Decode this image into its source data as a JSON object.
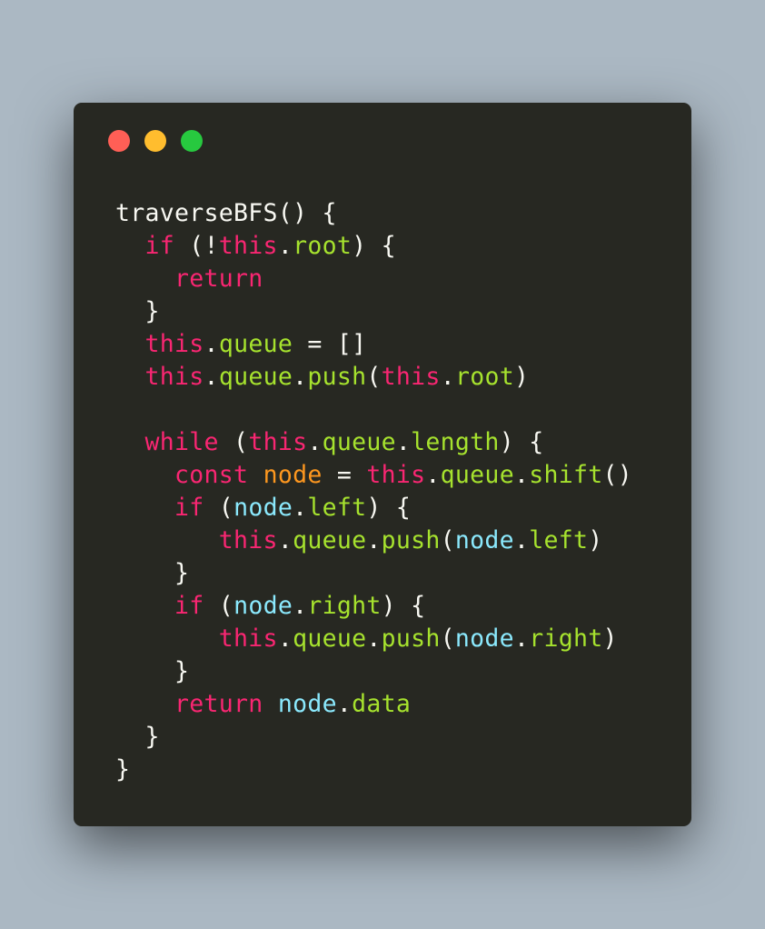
{
  "window": {
    "controls": [
      "close",
      "minimize",
      "maximize"
    ],
    "colors": {
      "background": "#272822",
      "page_background": "#abb8c3",
      "close": "#ff5f56",
      "minimize": "#ffbd2e",
      "maximize": "#27c93f",
      "keyword": "#f92672",
      "property": "#a6e22e",
      "variable": "#fd971f",
      "param": "#8be9fd",
      "plain": "#f8f8f2"
    }
  },
  "code": {
    "lines": [
      [
        {
          "t": "traverseBFS() {",
          "c": "pl"
        }
      ],
      [
        {
          "t": "  ",
          "c": "pl"
        },
        {
          "t": "if",
          "c": "kw"
        },
        {
          "t": " (!",
          "c": "pl"
        },
        {
          "t": "this",
          "c": "th"
        },
        {
          "t": ".",
          "c": "pl"
        },
        {
          "t": "root",
          "c": "pr"
        },
        {
          "t": ") {",
          "c": "pl"
        }
      ],
      [
        {
          "t": "    ",
          "c": "pl"
        },
        {
          "t": "return",
          "c": "kw"
        }
      ],
      [
        {
          "t": "  }",
          "c": "pl"
        }
      ],
      [
        {
          "t": "  ",
          "c": "pl"
        },
        {
          "t": "this",
          "c": "th"
        },
        {
          "t": ".",
          "c": "pl"
        },
        {
          "t": "queue",
          "c": "pr"
        },
        {
          "t": " = []",
          "c": "pl"
        }
      ],
      [
        {
          "t": "  ",
          "c": "pl"
        },
        {
          "t": "this",
          "c": "th"
        },
        {
          "t": ".",
          "c": "pl"
        },
        {
          "t": "queue",
          "c": "pr"
        },
        {
          "t": ".",
          "c": "pl"
        },
        {
          "t": "push",
          "c": "fn"
        },
        {
          "t": "(",
          "c": "pl"
        },
        {
          "t": "this",
          "c": "th"
        },
        {
          "t": ".",
          "c": "pl"
        },
        {
          "t": "root",
          "c": "pr"
        },
        {
          "t": ")",
          "c": "pl"
        }
      ],
      [
        {
          "t": "",
          "c": "pl"
        }
      ],
      [
        {
          "t": "  ",
          "c": "pl"
        },
        {
          "t": "while",
          "c": "kw"
        },
        {
          "t": " (",
          "c": "pl"
        },
        {
          "t": "this",
          "c": "th"
        },
        {
          "t": ".",
          "c": "pl"
        },
        {
          "t": "queue",
          "c": "pr"
        },
        {
          "t": ".",
          "c": "pl"
        },
        {
          "t": "length",
          "c": "pr"
        },
        {
          "t": ") {",
          "c": "pl"
        }
      ],
      [
        {
          "t": "    ",
          "c": "pl"
        },
        {
          "t": "const",
          "c": "kw"
        },
        {
          "t": " ",
          "c": "pl"
        },
        {
          "t": "node",
          "c": "vr"
        },
        {
          "t": " = ",
          "c": "pl"
        },
        {
          "t": "this",
          "c": "th"
        },
        {
          "t": ".",
          "c": "pl"
        },
        {
          "t": "queue",
          "c": "pr"
        },
        {
          "t": ".",
          "c": "pl"
        },
        {
          "t": "shift",
          "c": "fn"
        },
        {
          "t": "()",
          "c": "pl"
        }
      ],
      [
        {
          "t": "    ",
          "c": "pl"
        },
        {
          "t": "if",
          "c": "kw"
        },
        {
          "t": " (",
          "c": "pl"
        },
        {
          "t": "node",
          "c": "ar"
        },
        {
          "t": ".",
          "c": "pl"
        },
        {
          "t": "left",
          "c": "pr"
        },
        {
          "t": ") {",
          "c": "pl"
        }
      ],
      [
        {
          "t": "       ",
          "c": "pl"
        },
        {
          "t": "this",
          "c": "th"
        },
        {
          "t": ".",
          "c": "pl"
        },
        {
          "t": "queue",
          "c": "pr"
        },
        {
          "t": ".",
          "c": "pl"
        },
        {
          "t": "push",
          "c": "fn"
        },
        {
          "t": "(",
          "c": "pl"
        },
        {
          "t": "node",
          "c": "ar"
        },
        {
          "t": ".",
          "c": "pl"
        },
        {
          "t": "left",
          "c": "pr"
        },
        {
          "t": ")",
          "c": "pl"
        }
      ],
      [
        {
          "t": "    }",
          "c": "pl"
        }
      ],
      [
        {
          "t": "    ",
          "c": "pl"
        },
        {
          "t": "if",
          "c": "kw"
        },
        {
          "t": " (",
          "c": "pl"
        },
        {
          "t": "node",
          "c": "ar"
        },
        {
          "t": ".",
          "c": "pl"
        },
        {
          "t": "right",
          "c": "pr"
        },
        {
          "t": ") {",
          "c": "pl"
        }
      ],
      [
        {
          "t": "       ",
          "c": "pl"
        },
        {
          "t": "this",
          "c": "th"
        },
        {
          "t": ".",
          "c": "pl"
        },
        {
          "t": "queue",
          "c": "pr"
        },
        {
          "t": ".",
          "c": "pl"
        },
        {
          "t": "push",
          "c": "fn"
        },
        {
          "t": "(",
          "c": "pl"
        },
        {
          "t": "node",
          "c": "ar"
        },
        {
          "t": ".",
          "c": "pl"
        },
        {
          "t": "right",
          "c": "pr"
        },
        {
          "t": ")",
          "c": "pl"
        }
      ],
      [
        {
          "t": "    }",
          "c": "pl"
        }
      ],
      [
        {
          "t": "    ",
          "c": "pl"
        },
        {
          "t": "return",
          "c": "kw"
        },
        {
          "t": " ",
          "c": "pl"
        },
        {
          "t": "node",
          "c": "ar"
        },
        {
          "t": ".",
          "c": "pl"
        },
        {
          "t": "data",
          "c": "pr"
        }
      ],
      [
        {
          "t": "  }",
          "c": "pl"
        }
      ],
      [
        {
          "t": "}",
          "c": "pl"
        }
      ]
    ]
  }
}
